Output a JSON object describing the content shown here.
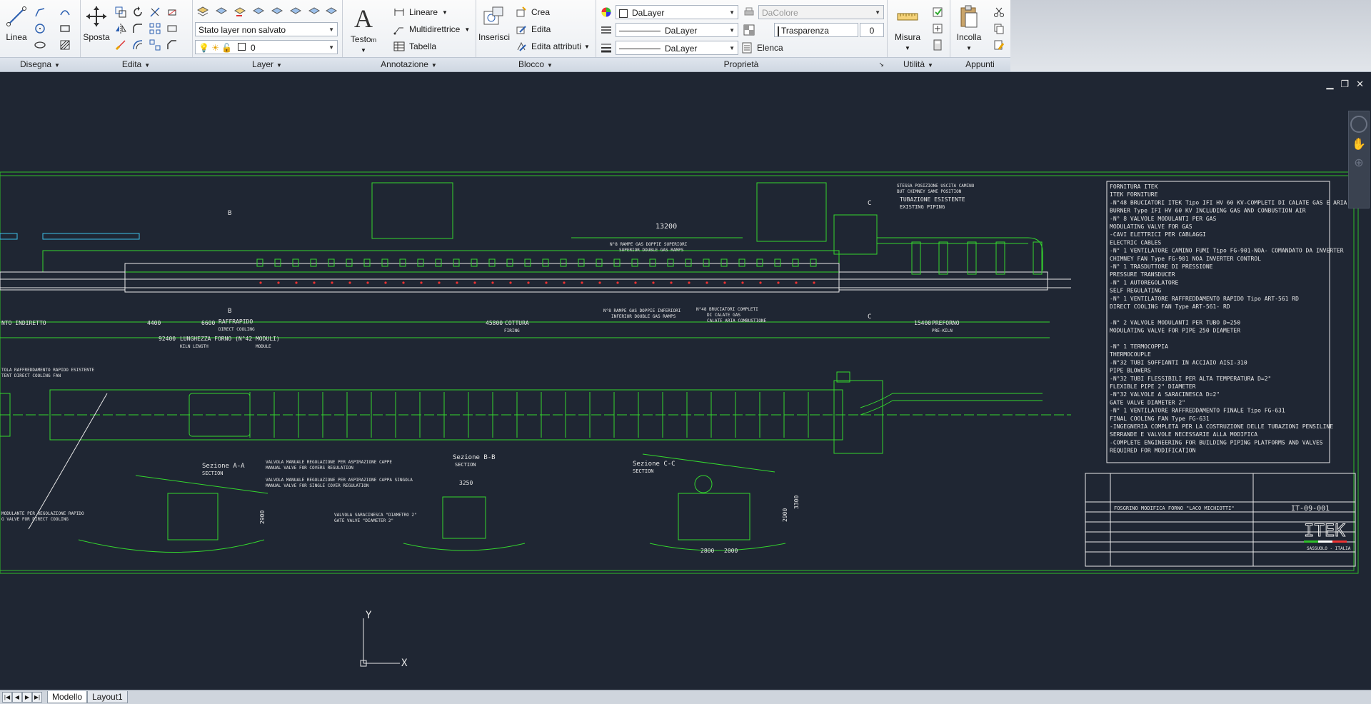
{
  "ribbon": {
    "draw": {
      "title": "Disegna",
      "line_label": "Linea"
    },
    "modify": {
      "title": "Edita",
      "move_label": "Sposta"
    },
    "layer": {
      "title": "Layer",
      "state_combo": "Stato layer non salvato",
      "current_layer": "0"
    },
    "annotation": {
      "title": "Annotazione",
      "text_label": "Testo",
      "text_sub": "m",
      "linear": "Lineare",
      "multileader": "Multidirettrice",
      "table": "Tabella"
    },
    "block": {
      "title": "Blocco",
      "insert": "Inserisci",
      "create": "Crea",
      "edit": "Edita",
      "edit_attr": "Edita attributi"
    },
    "properties": {
      "title": "Proprietà",
      "color": "DaLayer",
      "linetype": "DaLayer",
      "lineweight": "DaLayer",
      "plotstyle": "DaColore",
      "transparency_label": "Trasparenza",
      "transparency_value": "0",
      "list": "Elenca"
    },
    "utilities": {
      "title": "Utilità",
      "measure": "Misura"
    },
    "clipboard": {
      "title": "Appunti",
      "paste": "Incolla"
    }
  },
  "tabs": {
    "model": "Modello",
    "layout1": "Layout1"
  },
  "ucs": {
    "x": "X",
    "y": "Y"
  },
  "drawing": {
    "dims": {
      "d13200": "13200",
      "d4400": "4400",
      "d6600": "6600",
      "d45800": "45800",
      "d15400": "15400",
      "d92400": "92400",
      "d3250": "3250",
      "d2900a": "2900",
      "d2900b": "2900",
      "d3300": "3300",
      "d2800": "2800",
      "d2000": "2000"
    },
    "labels": {
      "indirect": "NTO INDIRETTO",
      "raffrapido": "RAFFRAPIDO",
      "direct_cooling": "DIRECT COOLING",
      "cottura": "COTTURA",
      "firing": "FIRING",
      "preforno": "PREFORNO",
      "prekiln": "PRE-KILN",
      "lunghezza": "LUNGHEZZA FORNO (N°42 MODULI)",
      "kiln_length": "KILN LENGTH",
      "module": "MODULE",
      "tubazione": "TUBAZIONE ESISTENTE",
      "existing": "EXISTING PIPING",
      "sezA": "Sezione A-A",
      "sezB": "Sezione B-B",
      "sezC": "Sezione C-C",
      "section": "SECTION",
      "rampe_sup": "N°8 RAMPE GAS DOPPIE SUPERIORI",
      "rampe_sup_en": "SUPERIOR DOUBLE GAS RAMPS",
      "rampe_inf": "N°8 RAMPE GAS DOPPIE INFERIORI",
      "rampe_inf_en": "INFERIOR DOUBLE GAS RAMPS",
      "bruciatori": "N°48 BRUCIATORI COMPLETI",
      "calate": "DI CALATE GAS",
      "calate_en": "CALATE ARIA COMBUSTIONE",
      "stessa": "STESSA POSIZIONE USCITA CAMINO",
      "stessa_en": "BUT CHIMNEY SAME POSITION",
      "valvola_a1": "VALVOLA MANUALE REGOLAZIONE PER ASPIRAZIONE CAPPE",
      "valvola_a1_en": "MANUAL VALVE FOR COVERS REGULATION",
      "valvola_a2": "VALVOLA MANUALE REGOLAZIONE PER ASPIRAZIONE CAPPA SINGOLA",
      "valvola_a2_en": "MANUAL VALVE FOR SINGLE COVER REGULATION",
      "saracinesca": "VALVOLA SARACINESCA \"DIAMETRO 2\"",
      "saracinesca_en": "GATE VALVE \"DIAMETER 2\"",
      "raff_esist": "TOLA RAFFREDDAMENTO RAPIDO ESISTENTE",
      "raff_esist_en": "TENT DIRECT COOLING FAN",
      "modulante": "MODULANTE PER REGOLAZIONE RAPIDO",
      "modulante_en": "G VALVE FOR DIRECT COOLING",
      "tag_b": "B",
      "tag_c": "C"
    },
    "notes": [
      "FORNITURA ITEK",
      "ITEK FORNITURE",
      "-N°48 BRUCIATORI ITEK Tipo IFI HV 60 KV-COMPLETI DI CALATE GAS E ARIA",
      "        BURNER Type IFI HV 60 KV  INCLUDING GAS AND CONBUSTION AIR",
      "-N° 8 VALVOLE MODULANTI PER GAS",
      "      MODULATING VALVE FOR GAS",
      "-CAVI ELETTRICI PER CABLAGGI",
      " ELECTRIC CABLES",
      "-N° 1 VENTILATORE CAMINO FUMI Tipo FG-901-NOA- COMANDATO DA INVERTER",
      "      CHIMNEY FAN Type FG-901 NOA INVERTER CONTROL",
      "-N° 1 TRASDUTTORE DI PRESSIONE",
      "      PRESSURE TRANSDUCER",
      "-N° 1 AUTOREGOLATORE",
      "      SELF REGULATING",
      "-N° 1 VENTILATORE RAFFREDDAMENTO RAPIDO Tipo ART-561 RD",
      "      DIRECT COOLING FAN Type ART-561- RD",
      "",
      "-N° 2 VALVOLE MODULANTI PER TUBO D=250",
      "      MODULATING VALVE FOR PIPE 250  DIAMETER",
      "",
      "-N° 1 TERMOCOPPIA",
      "      THERMOCOUPLE",
      "-N°32 TUBI SOFFIANTI IN ACCIAIO AISI-310",
      "      PIPE BLOWERS",
      "-N°32 TUBI FLESSIBILI PER ALTA TEMPERATURA  D=2\"",
      "      FLEXIBLE PIPE 2\" DIAMETER",
      "-N°32 VALVOLE A SARACINESCA D=2\"",
      "      GATE VALVE DIAMETER 2\"",
      "-N° 1 VENTILATORE RAFFREDDAMENTO FINALE Tipo FG-631",
      "      FINAL COOLING FAN Type FG-631",
      "-INGEGNERIA COMPLETA PER LA COSTRUZIONE DELLE TUBAZIONI PENSILINE",
      " SERRANDE E VALVOLE NECESSARIE ALLA MODIFICA",
      "-COMPLETE ENGINEERING FOR  BUILDING PIPING PLATFORMS AND VALVES",
      " REQUIRED FOR MODIFICATION"
    ],
    "title_block": {
      "code": "IT-09-001",
      "title": "FOSGRINO MODIFICA FORNO \"LACO MICHIOTTI\"",
      "logo": "ITEK",
      "city": "SASSUOLO - ITALIA"
    }
  }
}
